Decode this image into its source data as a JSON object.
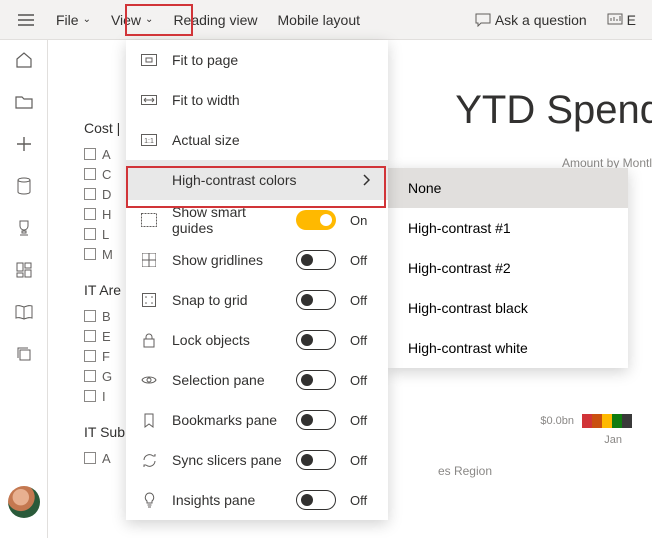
{
  "topbar": {
    "file": "File",
    "view": "View",
    "reading_view": "Reading view",
    "mobile_layout": "Mobile layout",
    "ask": "Ask a question",
    "explore": "E"
  },
  "filters": {
    "cost_title": "Cost |",
    "cost_items": [
      "A",
      "C",
      "D",
      "H",
      "L",
      "M"
    ],
    "area_title": "IT Are",
    "area_items": [
      "B",
      "E",
      "F",
      "G",
      "I"
    ],
    "sub_title": "IT Sub",
    "sub_items": [
      "A"
    ]
  },
  "report": {
    "title": "YTD Spend",
    "subtitle": "Amount by Montl",
    "y0": "$0.0bn",
    "x0": "Jan",
    "region": "es Region",
    "swatches": [
      "#d13438",
      "#ca5010",
      "#ffb900",
      "#107c10",
      "#0078d4",
      "#5c2d91"
    ]
  },
  "dropdown": {
    "fit_page": "Fit to page",
    "fit_width": "Fit to width",
    "actual_size": "Actual size",
    "high_contrast": "High-contrast colors",
    "smart_guides": "Show smart guides",
    "gridlines": "Show gridlines",
    "snap": "Snap to grid",
    "lock": "Lock objects",
    "selection": "Selection pane",
    "bookmarks": "Bookmarks pane",
    "sync": "Sync slicers pane",
    "insights": "Insights pane",
    "on": "On",
    "off": "Off"
  },
  "submenu": {
    "none": "None",
    "hc1": "High-contrast #1",
    "hc2": "High-contrast #2",
    "hcb": "High-contrast black",
    "hcw": "High-contrast white"
  }
}
